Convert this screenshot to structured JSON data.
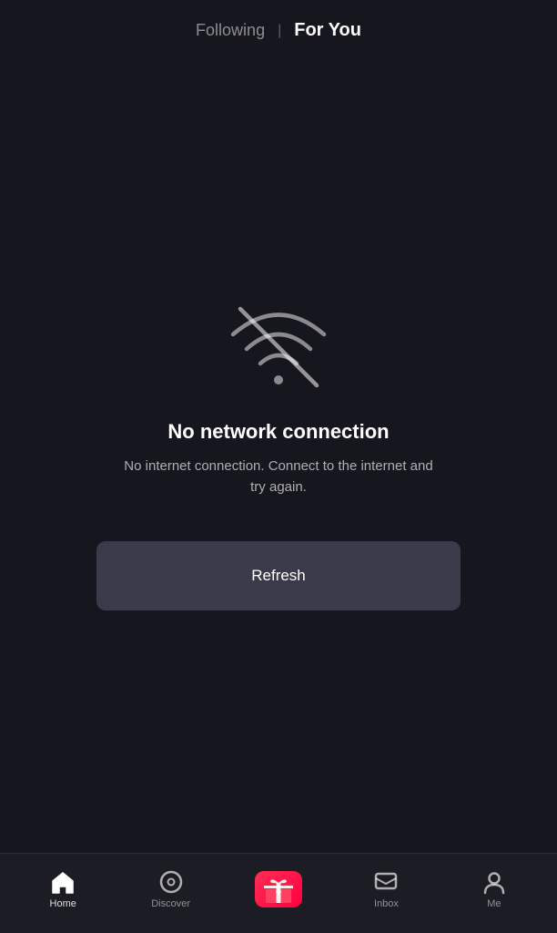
{
  "header": {
    "following_label": "Following",
    "divider": "|",
    "for_you_label": "For You"
  },
  "error": {
    "title": "No network connection",
    "subtitle": "No internet connection. Connect to the internet and try again."
  },
  "refresh_button": {
    "label": "Refresh"
  },
  "bottom_nav": {
    "items": [
      {
        "id": "home",
        "label": "Home",
        "active": true
      },
      {
        "id": "discover",
        "label": "Discover",
        "active": false
      },
      {
        "id": "create",
        "label": "",
        "active": false
      },
      {
        "id": "inbox",
        "label": "Inbox",
        "active": false
      },
      {
        "id": "me",
        "label": "Me",
        "active": false
      }
    ]
  },
  "colors": {
    "background": "#16161e",
    "active_tab": "#ffffff",
    "inactive_tab": "rgba(255,255,255,0.5)",
    "refresh_bg": "#3a3a4a",
    "gift_red": "#ff2d55"
  }
}
